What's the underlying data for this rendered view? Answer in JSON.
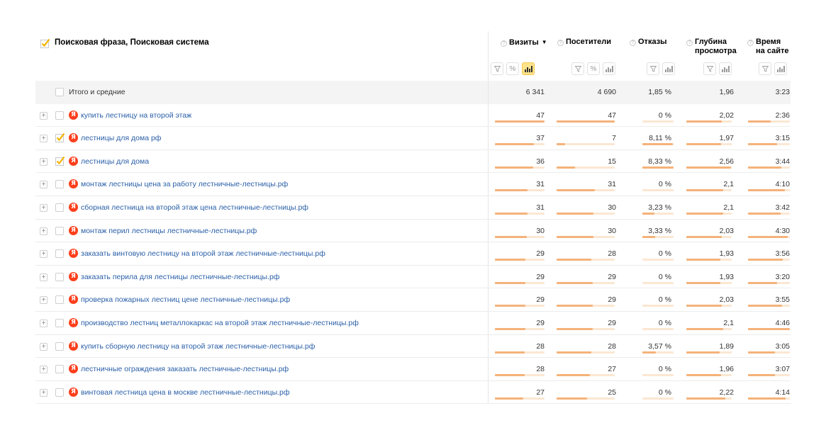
{
  "header": {
    "title": "Поисковая фраза, Поисковая система",
    "columns": [
      {
        "key": "visits",
        "label": "Визиты",
        "sorted": "▼"
      },
      {
        "key": "visitors",
        "label": "Посетители"
      },
      {
        "key": "bounces",
        "label": "Отказы"
      },
      {
        "key": "depth",
        "label_line1": "Глубина",
        "label_line2": "просмотра"
      },
      {
        "key": "time",
        "label_line1": "Время",
        "label_line2": "на сайте"
      }
    ],
    "help_icon": "?",
    "filter_icon": "filter-icon",
    "percent_icon": "%",
    "bar_icon": "bar-chart-icon"
  },
  "total": {
    "label": "Итого и средние",
    "visits": "6 341",
    "visitors": "4 690",
    "bounces": "1,85 %",
    "depth": "1,96",
    "time": "3:23"
  },
  "rows": [
    {
      "phrase": "купить лестницу на второй этаж",
      "checked": false,
      "visits": "47",
      "visitors": "47",
      "bounces": "0 %",
      "depth": "2,02",
      "time": "2:36",
      "level": [
        1.0,
        1.0,
        0.0,
        0.78,
        0.55
      ]
    },
    {
      "phrase": "лестницы для дома рф",
      "checked": true,
      "visits": "37",
      "visitors": "7",
      "bounces": "8,11 %",
      "depth": "1,97",
      "time": "3:15",
      "level": [
        0.79,
        0.15,
        0.97,
        0.76,
        0.69
      ]
    },
    {
      "phrase": "лестницы для дома",
      "checked": true,
      "visits": "36",
      "visitors": "15",
      "bounces": "8,33 %",
      "depth": "2,56",
      "time": "3:44",
      "level": [
        0.77,
        0.32,
        1.0,
        0.99,
        0.79
      ]
    },
    {
      "phrase": "монтаж лестницы цена за работу лестничные-лестницы.рф",
      "checked": false,
      "visits": "31",
      "visitors": "31",
      "bounces": "0 %",
      "depth": "2,1",
      "time": "4:10",
      "level": [
        0.66,
        0.66,
        0.0,
        0.81,
        0.88
      ]
    },
    {
      "phrase": "сборная лестница на второй этаж цена  лестничные-лестницы.рф",
      "checked": false,
      "visits": "31",
      "visitors": "30",
      "bounces": "3,23 %",
      "depth": "2,1",
      "time": "3:42",
      "level": [
        0.66,
        0.64,
        0.39,
        0.81,
        0.78
      ]
    },
    {
      "phrase": "монтаж перил лестницы  лестничные-лестницы.рф",
      "checked": false,
      "visits": "30",
      "visitors": "30",
      "bounces": "3,33 %",
      "depth": "2,03",
      "time": "4:30",
      "level": [
        0.64,
        0.64,
        0.4,
        0.78,
        0.95
      ]
    },
    {
      "phrase": "заказать винтовую лестницу на второй этаж лестничные-лестницы.рф",
      "checked": false,
      "visits": "29",
      "visitors": "28",
      "bounces": "0 %",
      "depth": "1,93",
      "time": "3:56",
      "level": [
        0.62,
        0.6,
        0.0,
        0.75,
        0.83
      ]
    },
    {
      "phrase": "заказать перила для лестницы лестничные-лестницы.рф",
      "checked": false,
      "visits": "29",
      "visitors": "29",
      "bounces": "0 %",
      "depth": "1,93",
      "time": "3:20",
      "level": [
        0.62,
        0.62,
        0.0,
        0.75,
        0.7
      ]
    },
    {
      "phrase": "проверка пожарных лестниц цене лестничные-лестницы.рф",
      "checked": false,
      "visits": "29",
      "visitors": "29",
      "bounces": "0 %",
      "depth": "2,03",
      "time": "3:55",
      "level": [
        0.62,
        0.62,
        0.0,
        0.78,
        0.82
      ]
    },
    {
      "phrase": "производство лестниц металлокаркас на второй этаж лестничные-лестницы.рф",
      "checked": false,
      "visits": "29",
      "visitors": "29",
      "bounces": "0 %",
      "depth": "2,1",
      "time": "4:46",
      "level": [
        0.62,
        0.62,
        0.0,
        0.81,
        1.0
      ]
    },
    {
      "phrase": "купить сборную лестницу на второй этаж лестничные-лестницы.рф",
      "checked": false,
      "visits": "28",
      "visitors": "28",
      "bounces": "3,57 %",
      "depth": "1,89",
      "time": "3:05",
      "level": [
        0.6,
        0.6,
        0.43,
        0.73,
        0.64
      ]
    },
    {
      "phrase": "лестничные ограждения заказать лестничные-лестницы.рф",
      "checked": false,
      "visits": "28",
      "visitors": "27",
      "bounces": "0 %",
      "depth": "1,96",
      "time": "3:07",
      "level": [
        0.6,
        0.57,
        0.0,
        0.76,
        0.65
      ]
    },
    {
      "phrase": "винтовая лестница цена в москве лестничные-лестницы.рф",
      "checked": false,
      "visits": "27",
      "visitors": "25",
      "bounces": "0 %",
      "depth": "2,22",
      "time": "4:14",
      "level": [
        0.57,
        0.53,
        0.0,
        0.86,
        0.89
      ]
    }
  ],
  "colors": {
    "link": "#2a5fa8",
    "yandex_badge": "#fc3f1d",
    "bar_fill": "#f4b27a",
    "bar_track": "#fbe7d2",
    "active_tool": "#ffe38a",
    "checkmark": "#f2b400"
  }
}
